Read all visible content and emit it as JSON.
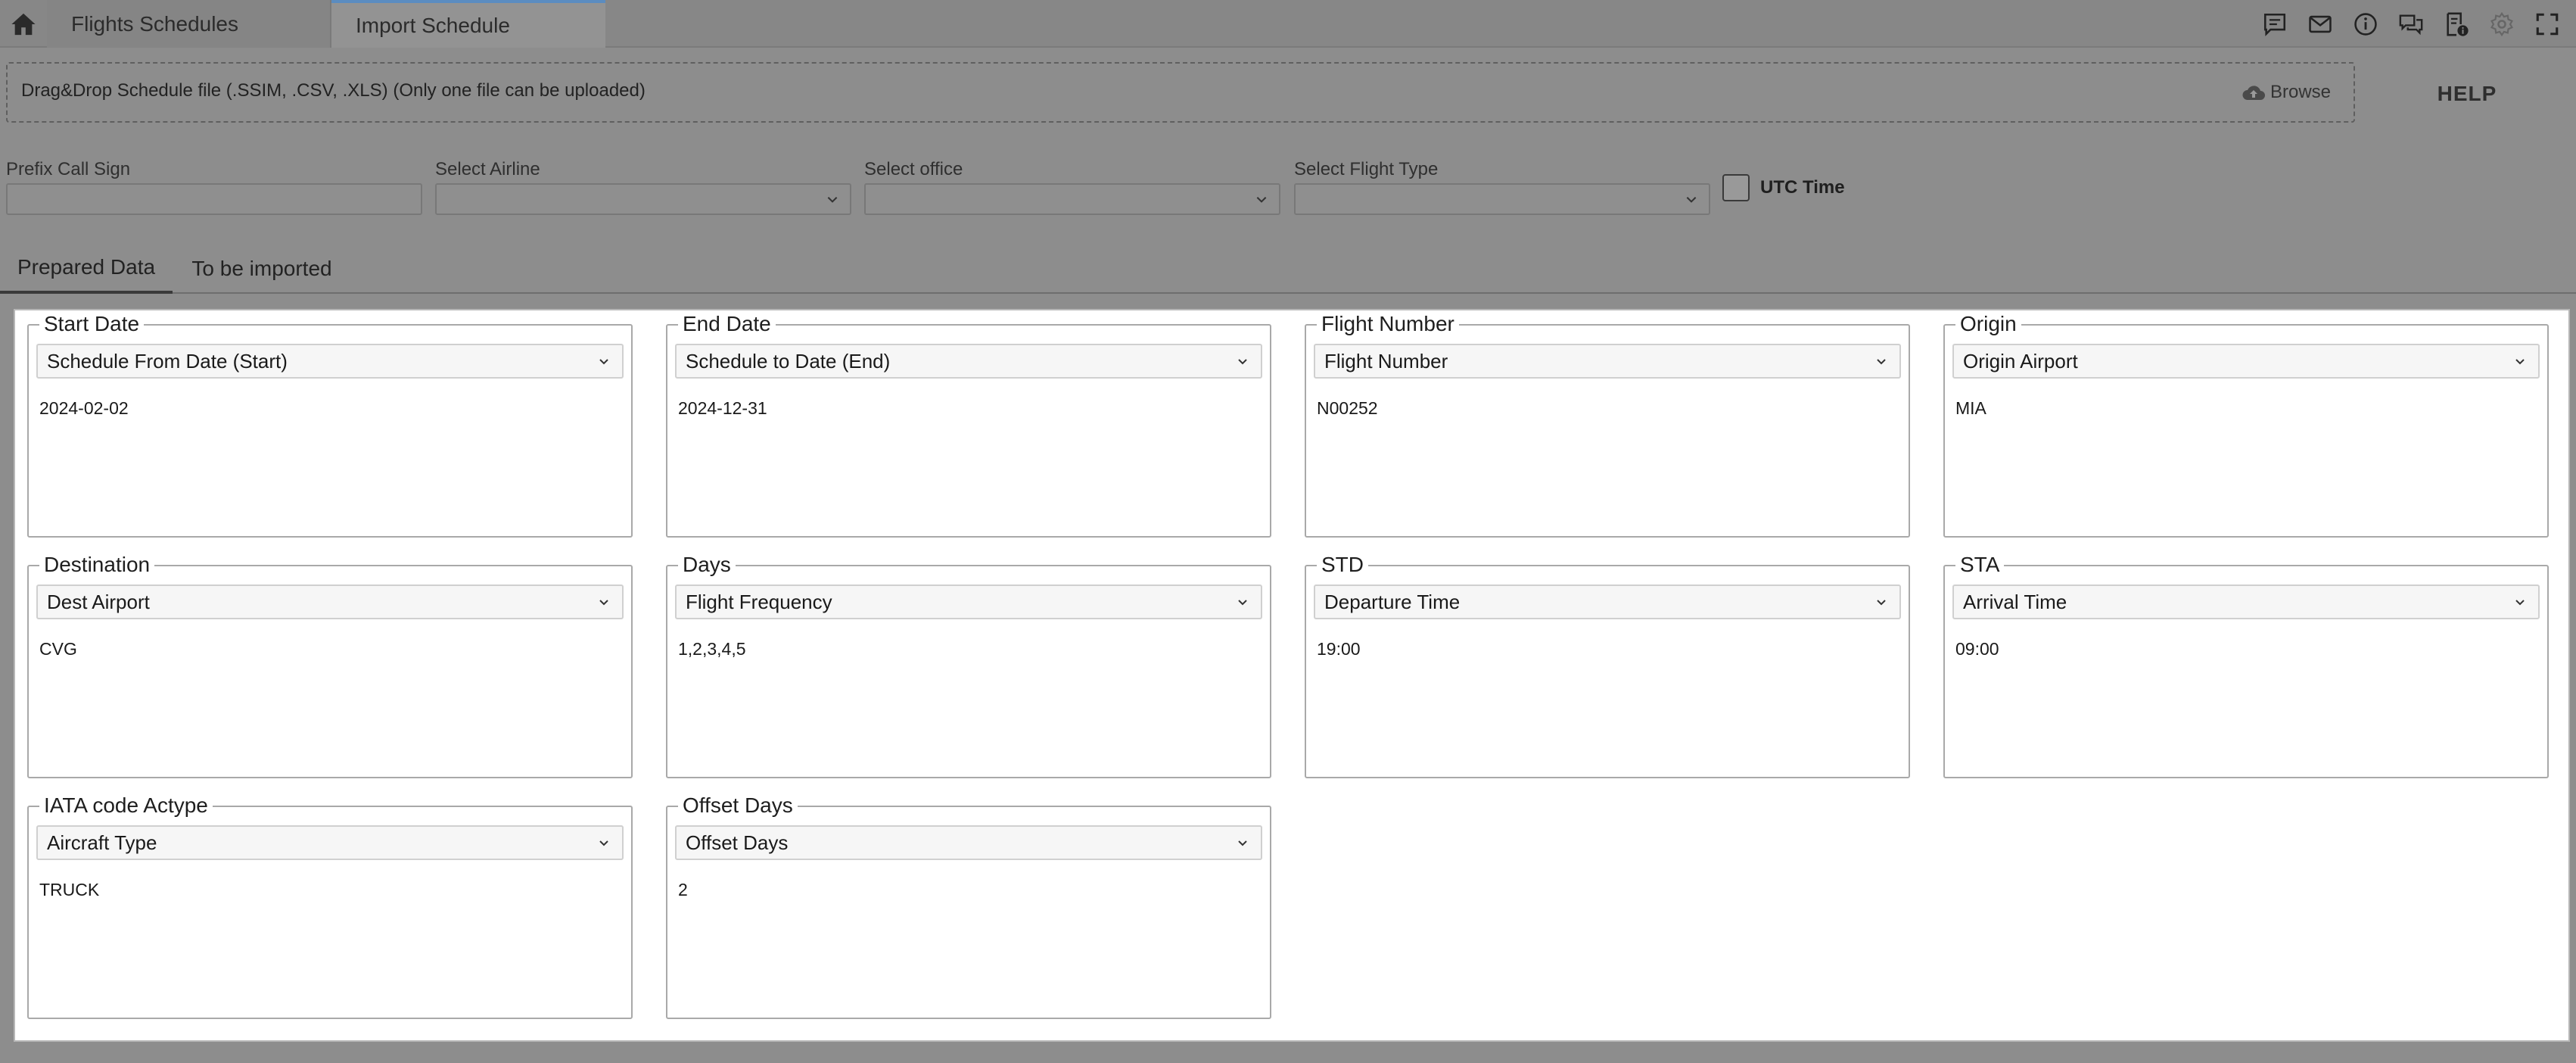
{
  "header": {
    "tabs": [
      {
        "label": "Flights Schedules"
      },
      {
        "label": "Import Schedule"
      }
    ],
    "icons": [
      "home-icon",
      "comment-icon",
      "mail-icon",
      "info-icon",
      "chat-icon",
      "document-info-icon",
      "gear-icon",
      "fullscreen-icon"
    ]
  },
  "upload": {
    "drop_text": "Drag&Drop Schedule file (.SSIM, .CSV, .XLS) (Only one file can be uploaded)",
    "browse_label": "Browse",
    "help_label": "HELP"
  },
  "filters": {
    "prefix_call_sign": {
      "label": "Prefix Call Sign",
      "value": ""
    },
    "airline": {
      "label": "Select Airline",
      "value": ""
    },
    "office": {
      "label": "Select office",
      "value": ""
    },
    "flight_type": {
      "label": "Select Flight Type",
      "value": ""
    },
    "utc_time": {
      "label": "UTC Time",
      "checked": false
    }
  },
  "data_tabs": [
    {
      "label": "Prepared Data",
      "active": true
    },
    {
      "label": "To be imported",
      "active": false
    }
  ],
  "mappings": [
    {
      "title": "Start Date",
      "field": "Schedule From Date (Start)",
      "sample": "2024-02-02"
    },
    {
      "title": "End Date",
      "field": "Schedule to Date (End)",
      "sample": "2024-12-31"
    },
    {
      "title": "Flight Number",
      "field": "Flight Number",
      "sample": "N00252"
    },
    {
      "title": "Origin",
      "field": "Origin Airport",
      "sample": "MIA"
    },
    {
      "title": "Destination",
      "field": "Dest Airport",
      "sample": "CVG"
    },
    {
      "title": "Days",
      "field": "Flight Frequency",
      "sample": "1,2,3,4,5"
    },
    {
      "title": "STD",
      "field": "Departure Time",
      "sample": "19:00"
    },
    {
      "title": "STA",
      "field": "Arrival Time",
      "sample": "09:00"
    },
    {
      "title": "IATA code Actype",
      "field": "Aircraft Type",
      "sample": "TRUCK"
    },
    {
      "title": "Offset Days",
      "field": "Offset Days",
      "sample": "2"
    }
  ]
}
